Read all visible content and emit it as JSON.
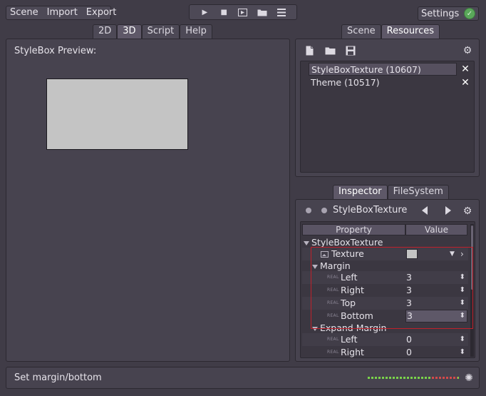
{
  "menu": {
    "scene": "Scene",
    "import": "Import",
    "export": "Export"
  },
  "playbar": {
    "play_icon": "play-icon",
    "stop_icon": "stop-icon",
    "play_scene_icon": "play-scene-icon",
    "open_icon": "folder-icon",
    "list_icon": "list-icon"
  },
  "settings": {
    "label": "Settings",
    "status_icon": "check-icon"
  },
  "main_tabs": [
    "2D",
    "3D",
    "Script",
    "Help"
  ],
  "main_tabs_active": "3D",
  "preview": {
    "label": "StyleBox Preview:",
    "box_color": "#c4c4c4"
  },
  "scene_tabs": {
    "scene": "Scene",
    "resources": "Resources",
    "active": "Resources"
  },
  "resources": {
    "toolbar": {
      "new_icon": "new-file-icon",
      "open_icon": "folder-icon",
      "save_icon": "save-icon",
      "gear_icon": "gear-icon"
    },
    "items": [
      {
        "label": "StyleBoxTexture (10607)",
        "selected": true
      },
      {
        "label": "Theme (10517)",
        "selected": false
      }
    ]
  },
  "dock_tabs": {
    "inspector": "Inspector",
    "filesystem": "FileSystem",
    "active": "Inspector"
  },
  "inspector": {
    "title": "StyleBoxTexture",
    "columns": {
      "property": "Property",
      "value": "Value"
    },
    "section": "StyleBoxTexture",
    "texture_label": "Texture",
    "margin_group": "Margin",
    "margin": [
      {
        "label": "Left",
        "value": "3"
      },
      {
        "label": "Right",
        "value": "3"
      },
      {
        "label": "Top",
        "value": "3"
      },
      {
        "label": "Bottom",
        "value": "3"
      }
    ],
    "expand_group": "Expand Margin",
    "expand": [
      {
        "label": "Left",
        "value": "0"
      },
      {
        "label": "Right",
        "value": "0"
      }
    ],
    "real_tag": "REAL"
  },
  "status": {
    "text": "Set margin/bottom"
  },
  "colors": {
    "background": "#403c47",
    "selection_outline": "#c0202a",
    "accent_green": "#5aa85a"
  }
}
